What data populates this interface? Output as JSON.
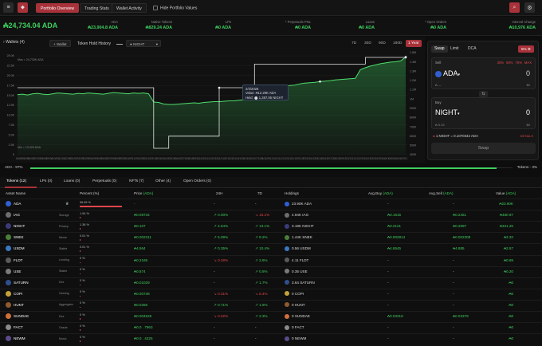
{
  "colors": {
    "accent": "#a8323a",
    "green": "#3ecf5e",
    "red": "#e0454b"
  },
  "nav": {
    "tabs": [
      {
        "label": "Portfolio Overview",
        "active": true
      },
      {
        "label": "Trading Stats",
        "active": false
      },
      {
        "label": "Wallet Activity",
        "active": false
      }
    ],
    "hide_values_label": "Hide Portfolio Values",
    "right_icons": [
      "search-icon",
      "gear-icon"
    ]
  },
  "stats": {
    "total": "₳24,734.04 ADA",
    "items": [
      {
        "label": "ADA",
        "value": "₳23,904.8 ADA"
      },
      {
        "label": "Native Tokens",
        "value": "₳829.24 ADA"
      },
      {
        "label": "LPs",
        "value": "₳0 ADA"
      },
      {
        "label": "* Perpetuals PNL",
        "value": "₳0 ADA"
      },
      {
        "label": "Loans",
        "value": "₳0 ADA"
      },
      {
        "label": "* Open Orders",
        "value": "₳0 ADA"
      },
      {
        "label": "Interval Change",
        "value": "₳10,976 ADA"
      }
    ]
  },
  "chart_controls": {
    "wallets": "Wallets (4)",
    "add_wallet": "+ Wallet",
    "token_hold_history": "Token Hold History",
    "token_select": "NIGHT",
    "ranges": [
      {
        "label": "7D",
        "active": false
      },
      {
        "label": "30D",
        "active": false
      },
      {
        "label": "90D",
        "active": false
      },
      {
        "label": "180D",
        "active": false
      },
      {
        "label": "1 Year",
        "active": true
      }
    ]
  },
  "chart_data": {
    "type": "line",
    "max_label": "Max = 24,733K ADA",
    "min_label": "Min = 13,329 ADA",
    "y_left_ticks": [
      "25.0K",
      "22.5K",
      "20.0K",
      "17.5K",
      "15.0K",
      "12.5K",
      "10.0K",
      "7.5K",
      "5.0K",
      "2.5K",
      "0"
    ],
    "y_right_ticks": [
      "1.5M",
      "1.4M",
      "1.3M",
      "1.2M",
      "1.1M",
      "1M",
      "900K",
      "800K",
      "700K",
      "600K",
      "500K",
      "400K"
    ],
    "x_ticks": [
      "04/08",
      "05/08",
      "06/08",
      "07/08",
      "08/08",
      "09/08",
      "10/08",
      "11/08",
      "12/08",
      "01/09",
      "02/09",
      "03/09",
      "04/09",
      "05/09",
      "06/09",
      "07/09",
      "08/09",
      "09/09",
      "10/09",
      "11/09",
      "12/09",
      "01/10",
      "02/10",
      "03/10",
      "04/10",
      "05/10",
      "06/10",
      "07/10",
      "08/10",
      "09/10",
      "10/10",
      "11/10",
      "12/10",
      "01/11",
      "02/11",
      "03/11",
      "04/11",
      "05/11",
      "06/11",
      "07/11",
      "08/11",
      "09/11",
      "10/11",
      "11/11",
      "12/11",
      "01/12",
      "02/12",
      "03/12",
      "04/12",
      "05/12",
      "06/12",
      "07/12",
      "08/12",
      "09/12",
      "10/12",
      "11/12",
      "12/12",
      "01/01",
      "02/01",
      "03/01",
      "04/01",
      "05/01",
      "06/01",
      "07/01"
    ],
    "series": [
      {
        "values": [
          15.2,
          15.3,
          15.1,
          15.4,
          15.5,
          15.3,
          15.2,
          15.4,
          15.6,
          15.5,
          15.4,
          15.3,
          15.5,
          15.4,
          15.6,
          15.5,
          15.4,
          15.3,
          15.5,
          15.7,
          15.6,
          15.5,
          15.4,
          15.6,
          15.5,
          15.6,
          15.4,
          13.3,
          13.2,
          12.8,
          12.7,
          12.7,
          12.8,
          12.9,
          13.0,
          13.1,
          13.0,
          13.2,
          13.3,
          13.4,
          13.4,
          13.5,
          13.6,
          13.6,
          13.8,
          13.9,
          14.1,
          16.0,
          16.2,
          16.2,
          16.3,
          16.8,
          17.0,
          17.3,
          17.5,
          17.6,
          17.9,
          18.1,
          18.2,
          18.3,
          18.5,
          18.6,
          18.7,
          18.9,
          19.0,
          19.1,
          19.2,
          19.3,
          21.5,
          22.0,
          22.4,
          22.7,
          23.0,
          23.2,
          23.4,
          23.5,
          23.7,
          24.7
        ]
      },
      {
        "values": [
          1.0,
          1.0,
          1.0,
          1.0,
          1.0,
          1.0,
          1.0,
          1.0,
          1.0,
          1.0,
          1.0,
          1.0,
          1.0,
          1.0,
          1.0,
          1.0,
          1.0,
          1.0,
          1.0,
          1.0,
          1.0,
          1.0,
          1.0,
          1.0,
          1.0,
          1.0,
          1.0,
          0.0,
          0.0,
          0.0,
          0.2,
          0.2,
          0.2,
          0.2,
          0.2,
          0.2,
          0.2,
          0.2,
          0.2,
          0.2,
          1.0,
          1.0,
          1.0,
          1.0,
          1.0,
          1.0,
          1.0,
          1.39,
          1.39,
          1.39,
          1.39,
          1.39,
          1.39,
          1.39,
          1.39,
          1.39,
          1.39,
          1.39,
          1.39,
          1.39,
          1.39,
          1.39,
          1.39,
          1.39,
          1.39,
          1.39,
          1.39,
          1.39,
          1.39,
          1.5,
          1.5,
          1.5,
          1.5,
          1.5,
          1.5,
          1.5,
          1.5,
          1.5
        ]
      }
    ],
    "tooltip": {
      "date": "2/4/2026",
      "value": "Value: ₳12.29K ADA",
      "held": "Held: ⬤ 1,387.95 NIGHT"
    }
  },
  "swap": {
    "tabs": [
      {
        "label": "Swap",
        "active": true
      },
      {
        "label": "Limit",
        "active": false
      },
      {
        "label": "DCA",
        "active": false
      }
    ],
    "slippage": "5%",
    "sell_label": "Sell",
    "sell_pcts": [
      "25%",
      "50%",
      "75%",
      "MAX"
    ],
    "sell_token": "ADA",
    "sell_amount": "0",
    "sell_balance": "₳ —",
    "sell_usd": "$0",
    "buy_label": "Buy",
    "buy_token": "NIGHT",
    "buy_amount": "0",
    "buy_balance": "₳ 5.33",
    "buy_usd": "$0",
    "rate": "1 NIGHT = 0.1070342 ADA",
    "details": "DETAILS",
    "swap_button": "Swap"
  },
  "alloc": {
    "left": "ADA - 97%",
    "right": "Tokens - 3%"
  },
  "tabs": [
    {
      "label": "Tokens (12)",
      "active": true
    },
    {
      "label": "LPs (0)",
      "active": false
    },
    {
      "label": "Loans (0)",
      "active": false
    },
    {
      "label": "Perpetuals (0)",
      "active": false
    },
    {
      "label": "NFTs (7)",
      "active": false
    },
    {
      "label": "Other (4)",
      "active": false
    },
    {
      "label": "Open Orders (0)",
      "active": false
    }
  ],
  "table": {
    "headers": {
      "asset": "Asset Name",
      "percent": "Percent (%)",
      "price": "Price",
      "price_unit": "(ADA)",
      "h24": "24H",
      "d7": "7D",
      "holdings": "Holdings",
      "avg_buy": "Avg.Buy",
      "avg_buy_unit": "(ADA)",
      "avg_sell": "Avg.Sell",
      "avg_sell_unit": "(ADA)",
      "value": "Value",
      "value_unit": "(ADA)"
    },
    "rows": [
      {
        "name": "ADA",
        "tag": "",
        "pct": "96.65 %",
        "pct_frac": 0.9665,
        "price": "-",
        "h24": "-",
        "h24_dir": "none",
        "d7": "-",
        "d7_dir": "none",
        "holdings": "23.90K ADA",
        "avg_buy": "-",
        "avg_sell": "-",
        "value": "₳23.90K",
        "color": "#2f5fd0"
      },
      {
        "name": "IAG",
        "tag": "Storage",
        "pct": "1.94 %",
        "pct_frac": 0.0194,
        "price": "₳0.09734",
        "h24": "0.00%",
        "h24_dir": "up",
        "d7": "15.1%",
        "d7_dir": "down",
        "holdings": "4.94K IAG",
        "avg_buy": "₳0.1615",
        "avg_sell": "₳0.2451",
        "value": "₳480.97",
        "color": "#6d6d6d"
      },
      {
        "name": "NIGHT",
        "tag": "Privacy",
        "pct": "1.38 %",
        "pct_frac": 0.0138,
        "price": "₳0.107",
        "h24": "4.54%",
        "h24_dir": "up",
        "d7": "13.1%",
        "d7_dir": "up",
        "holdings": "3.19K NIGHT",
        "avg_buy": "₳0.2121",
        "avg_sell": "₳0.2697",
        "value": "₳341.26",
        "color": "#3b3b7a"
      },
      {
        "name": "SNEK",
        "tag": "Meme",
        "pct": "0.01 %",
        "pct_frac": 0.0001,
        "price": "₳0.002311",
        "h24": "5.09%",
        "h24_dir": "up",
        "d7": "8.2%",
        "d7_dir": "up",
        "holdings": "1.44K SNEK",
        "avg_buy": "₳0.002814",
        "avg_sell": "₳0.002308",
        "value": "₳3.32",
        "color": "#4a7f3a"
      },
      {
        "name": "USDM",
        "tag": "Stable",
        "pct": "0.01 %",
        "pct_frac": 0.0001,
        "price": "₳4.564",
        "h24": "0.35%",
        "h24_dir": "up",
        "d7": "10.4%",
        "d7_dir": "up",
        "holdings": "0.56 USDM",
        "avg_buy": "₳4.6545",
        "avg_sell": "₳4.885",
        "value": "₳2.57",
        "color": "#3b78c4"
      },
      {
        "name": "FLDT",
        "tag": "Lending",
        "pct": "0 %",
        "pct_frac": 0,
        "price": "₳0.2169",
        "h24": "0.28%",
        "h24_dir": "down",
        "d7": "2.6%",
        "d7_dir": "up",
        "holdings": "4.11 FLDT",
        "avg_buy": "-",
        "avg_sell": "-",
        "value": "₳0.89",
        "color": "#5a5a5a"
      },
      {
        "name": "USE",
        "tag": "Stable",
        "pct": "0 %",
        "pct_frac": 0,
        "price": "₳0.574",
        "h24": "-",
        "h24_dir": "none",
        "d7": "0.8%",
        "d7_dir": "up",
        "holdings": "0.35 USE",
        "avg_buy": "-",
        "avg_sell": "-",
        "value": "₳0.20",
        "color": "#7a7a7a"
      },
      {
        "name": "SATURN",
        "tag": "Dex",
        "pct": "0 %",
        "pct_frac": 0,
        "price": "₳0.01029",
        "h24": "-",
        "h24_dir": "none",
        "d7": "1.7%",
        "d7_dir": "up",
        "holdings": "3.64 SATURN",
        "avg_buy": "-",
        "avg_sell": "-",
        "value": "₳0",
        "color": "#2f4f8f"
      },
      {
        "name": "COPI",
        "tag": "Gaming",
        "pct": "0 %",
        "pct_frac": 0,
        "price": "₳0.00738",
        "h24": "0.31%",
        "h24_dir": "down",
        "d7": "8.4%",
        "d7_dir": "down",
        "holdings": "0 COPI",
        "avg_buy": "-",
        "avg_sell": "-",
        "value": "₳0",
        "color": "#c4a23a"
      },
      {
        "name": "HUNT",
        "tag": "Aggregator",
        "pct": "0 %",
        "pct_frac": 0,
        "price": "₳0.0256",
        "h24": "0.71%",
        "h24_dir": "up",
        "d7": "1.6%",
        "d7_dir": "up",
        "holdings": "0 HUNT",
        "avg_buy": "-",
        "avg_sell": "-",
        "value": "₳0",
        "color": "#8f5a2f"
      },
      {
        "name": "SUNDAE",
        "tag": "Dex",
        "pct": "0 %",
        "pct_frac": 0,
        "price": "₳0.004526",
        "h24": "0.02%",
        "h24_dir": "down",
        "d7": "2.3%",
        "d7_dir": "up",
        "holdings": "0 SUNDAE",
        "avg_buy": "₳0.03319",
        "avg_sell": "₳0.03379",
        "value": "₳0",
        "color": "#d06f3a"
      },
      {
        "name": "FACT",
        "tag": "Oracle",
        "pct": "0 %",
        "pct_frac": 0,
        "price": "₳0.0 . 7963",
        "h24": "-",
        "h24_dir": "none",
        "d7": "-",
        "d7_dir": "none",
        "holdings": "0 FACT",
        "avg_buy": "-",
        "avg_sell": "-",
        "value": "₳0",
        "color": "#8a8a8a"
      },
      {
        "name": "NEWM",
        "tag": "Music",
        "pct": "0 %",
        "pct_frac": 0,
        "price": "₳0.0 . 4225",
        "h24": "-",
        "h24_dir": "none",
        "d7": "-",
        "d7_dir": "none",
        "holdings": "0 NEWM",
        "avg_buy": "-",
        "avg_sell": "-",
        "value": "₳0",
        "color": "#5a4a8a"
      }
    ]
  }
}
